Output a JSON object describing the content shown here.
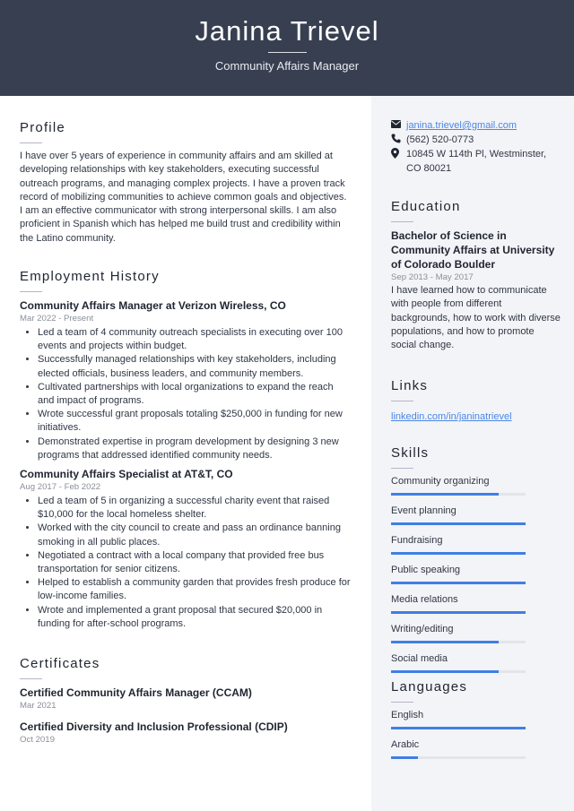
{
  "header": {
    "name": "Janina Trievel",
    "title": "Community Affairs Manager"
  },
  "profile": {
    "heading": "Profile",
    "text": "I have over 5 years of experience in community affairs and am skilled at developing relationships with key stakeholders, executing successful outreach programs, and managing complex projects. I have a proven track record of mobilizing communities to achieve common goals and objectives. I am an effective communicator with strong interpersonal skills. I am also proficient in Spanish which has helped me build trust and credibility within the Latino community."
  },
  "employment": {
    "heading": "Employment History",
    "jobs": [
      {
        "title": "Community Affairs Manager at Verizon Wireless, CO",
        "dates": "Mar 2022 - Present",
        "bullets": [
          "Led a team of 4 community outreach specialists in executing over 100 events and projects within budget.",
          "Successfully managed relationships with key stakeholders, including elected officials, business leaders, and community members.",
          "Cultivated partnerships with local organizations to expand the reach and impact of programs.",
          "Wrote successful grant proposals totaling $250,000 in funding for new initiatives.",
          "Demonstrated expertise in program development by designing 3 new programs that addressed identified community needs."
        ]
      },
      {
        "title": "Community Affairs Specialist at AT&T, CO",
        "dates": "Aug 2017 - Feb 2022",
        "bullets": [
          "Led a team of 5 in organizing a successful charity event that raised $10,000 for the local homeless shelter.",
          "Worked with the city council to create and pass an ordinance banning smoking in all public places.",
          "Negotiated a contract with a local company that provided free bus transportation for senior citizens.",
          "Helped to establish a community garden that provides fresh produce for low-income families.",
          "Wrote and implemented a grant proposal that secured $20,000 in funding for after-school programs."
        ]
      }
    ]
  },
  "certificates": {
    "heading": "Certificates",
    "items": [
      {
        "name": "Certified Community Affairs Manager (CCAM)",
        "date": "Mar 2021"
      },
      {
        "name": "Certified Diversity and Inclusion Professional (CDIP)",
        "date": "Oct 2019"
      }
    ]
  },
  "contact": {
    "email": "janina.trievel@gmail.com",
    "phone": "(562) 520-0773",
    "address": "10845 W 114th Pl, Westminster, CO 80021",
    "icons": {
      "email": "envelope-icon",
      "phone": "phone-icon",
      "address": "map-pin-icon"
    }
  },
  "education": {
    "heading": "Education",
    "degree": "Bachelor of Science in Community Affairs at University of Colorado Boulder",
    "dates": "Sep 2013 - May 2017",
    "description": "I have learned how to communicate with people from different backgrounds, how to work with diverse populations, and how to promote social change."
  },
  "links": {
    "heading": "Links",
    "items": [
      "linkedin.com/in/janinatrievel"
    ]
  },
  "skills": {
    "heading": "Skills",
    "items": [
      {
        "label": "Community organizing",
        "level": 0.8
      },
      {
        "label": "Event planning",
        "level": 1.0
      },
      {
        "label": "Fundraising",
        "level": 1.0
      },
      {
        "label": "Public speaking",
        "level": 1.0
      },
      {
        "label": "Media relations",
        "level": 1.0
      },
      {
        "label": "Writing/editing",
        "level": 0.8
      },
      {
        "label": "Social media",
        "level": 0.8
      }
    ]
  },
  "languages": {
    "heading": "Languages",
    "items": [
      {
        "label": "English",
        "level": 1.0
      },
      {
        "label": "Arabic",
        "level": 0.2
      }
    ]
  },
  "colors": {
    "header_bg": "#373f51",
    "sidebar_bg": "#f3f4f7",
    "accent": "#3f7fe6",
    "link": "#4a86e8"
  }
}
